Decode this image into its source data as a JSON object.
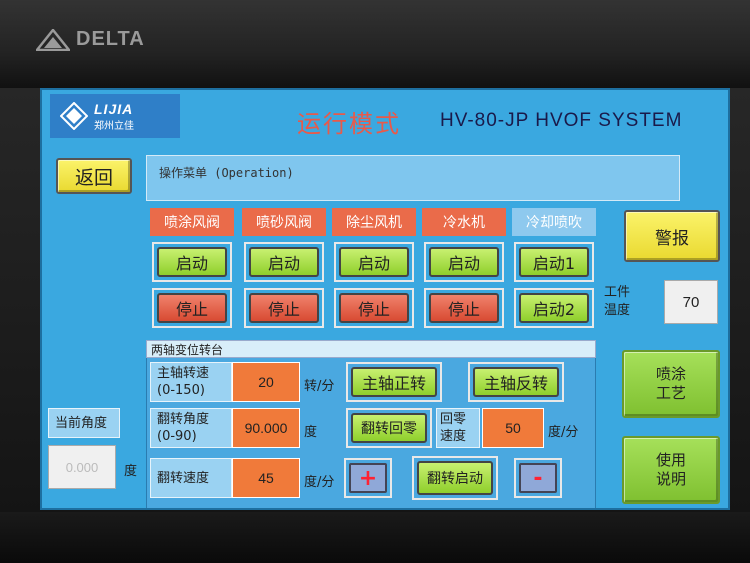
{
  "bezel": {
    "brand": "DELTA"
  },
  "header": {
    "logo_en": "LIJIA",
    "logo_cn": "郑州立佳",
    "mode_title": "运行模式",
    "system_title": "HV-80-JP HVOF SYSTEM"
  },
  "nav": {
    "back_label": "返回"
  },
  "menu": {
    "text": "操作菜单 (Operation)"
  },
  "alarm": {
    "label": "警报"
  },
  "devices": [
    {
      "name": "喷涂风阀",
      "btn1": "启动",
      "btn2": "停止"
    },
    {
      "name": "喷砂风阀",
      "btn1": "启动",
      "btn2": "停止"
    },
    {
      "name": "除尘风机",
      "btn1": "启动",
      "btn2": "停止"
    },
    {
      "name": "冷水机",
      "btn1": "启动",
      "btn2": "停止"
    },
    {
      "name": "冷却喷吹",
      "btn1": "启动1",
      "btn2": "启动2"
    }
  ],
  "workpiece_temp": {
    "label_line1": "工件",
    "label_line2": "温度",
    "value": "70"
  },
  "turntable": {
    "title": "两轴变位转台",
    "spindle_speed": {
      "label_line1": "主轴转速",
      "label_line2": "(0-150)",
      "value": "20",
      "unit": "转/分"
    },
    "flip_angle": {
      "label_line1": "翻转角度",
      "label_line2": "(0-90)",
      "value": "90.000",
      "unit": "度"
    },
    "flip_speed": {
      "label": "翻转速度",
      "value": "45",
      "unit": "度/分"
    },
    "spindle_forward": "主轴正转",
    "spindle_reverse": "主轴反转",
    "flip_home": "翻转回零",
    "home_speed": {
      "label_line1": "回零",
      "label_line2": "速度",
      "value": "50",
      "unit": "度/分"
    },
    "plus": "+",
    "flip_start": "翻转启动",
    "minus": "-"
  },
  "current_angle": {
    "label": "当前角度",
    "value": "0.000",
    "unit": "度"
  },
  "right_buttons": {
    "spray_process_line1": "喷涂",
    "spray_process_line2": "工艺",
    "manual_line1": "使用",
    "manual_line2": "说明"
  }
}
